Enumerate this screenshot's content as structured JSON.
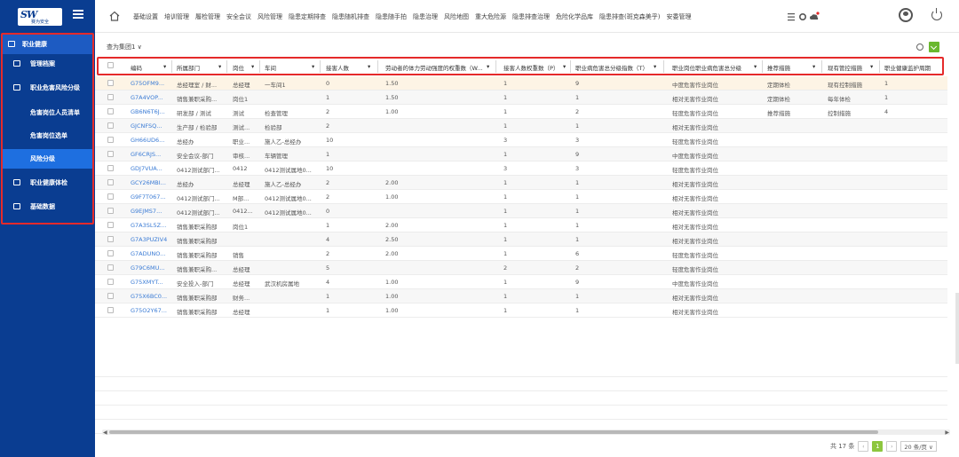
{
  "brand": {
    "logo_text": "SW",
    "logo_sub": "赛为安全"
  },
  "sidebar": {
    "items": [
      {
        "label": "职业健康",
        "top": true
      },
      {
        "label": "管理档案"
      },
      {
        "label": "职业危害风险分级"
      },
      {
        "label": "危害岗位人员清单",
        "sub": true
      },
      {
        "label": "危害岗位选单",
        "sub": true
      },
      {
        "label": "风险分级",
        "sub": true,
        "active": true
      },
      {
        "label": "职业健康体检"
      },
      {
        "label": "基础数据"
      }
    ]
  },
  "nav": {
    "items": [
      "基础设置",
      "培训管理",
      "履检管理",
      "安全会议",
      "风险管理",
      "隐患定期排查",
      "隐患随机排查",
      "隐患随手拍",
      "隐患治理",
      "风险地图",
      "重大危险源",
      "隐患排查治理",
      "危险化学品库",
      "隐患排查(斑克森美乎)",
      "安委管理"
    ]
  },
  "toolbar": {
    "filter_label": "查为集团1 ∨"
  },
  "table": {
    "headers": [
      "编码",
      "所属部门",
      "岗位",
      "车间",
      "接害人数",
      "劳动者的体力劳动强度的权重数（W...",
      "接害人数权重数（P）",
      "职业病危害总分级指数（T）",
      "职业岗位职业病危害总分级",
      "推荐措施",
      "现有管控措施",
      "职业健康监护周期"
    ],
    "rows": [
      [
        "G75OFM9...",
        "总经理室 / 财...",
        "总经理",
        "一车间1",
        "0",
        "1.50",
        "1",
        "9",
        "中度危害作业岗位",
        "定期体检",
        "现有控制措施",
        "1"
      ],
      [
        "G7A4VOP...",
        "销售兼职采购...",
        "岗位1",
        "",
        "1",
        "1.50",
        "1",
        "1",
        "相对无害作业岗位",
        "定期体检",
        "每年体检",
        "1"
      ],
      [
        "GB6N6T6J...",
        "研发部 / 测试",
        "测试",
        "检查管理",
        "2",
        "1.00",
        "1",
        "2",
        "轻度危害作业岗位",
        "推荐措施",
        "控制措施",
        "4"
      ],
      [
        "GJCNFSQ...",
        "生产部 / 检验部",
        "测试...",
        "检验部",
        "2",
        "",
        "1",
        "1",
        "相对无害作业岗位",
        "",
        "",
        ""
      ],
      [
        "GH66UD6...",
        "总经办",
        "职业...",
        "施人乙-总经办",
        "10",
        "",
        "3",
        "3",
        "轻度危害作业岗位",
        "",
        "",
        ""
      ],
      [
        "GF6CRJS...",
        "安全会议-部门",
        "审核...",
        "车辆管理",
        "1",
        "",
        "1",
        "9",
        "中度危害作业岗位",
        "",
        "",
        ""
      ],
      [
        "GDJ7VUA...",
        "0412测试部门...",
        "0412",
        "0412测试属地0...",
        "10",
        "",
        "3",
        "3",
        "轻度危害作业岗位",
        "",
        "",
        ""
      ],
      [
        "GCY26MBI...",
        "总经办",
        "总经理",
        "施人乙-总经办",
        "2",
        "2.00",
        "1",
        "1",
        "相对无害作业岗位",
        "",
        "",
        ""
      ],
      [
        "G9F7T067...",
        "0412测试部门...",
        "M部...",
        "0412测试属地0...",
        "2",
        "1.00",
        "1",
        "1",
        "相对无害作业岗位",
        "",
        "",
        ""
      ],
      [
        "G9EJMS7...",
        "0412测试部门...",
        "0412...",
        "0412测试属地0...",
        "0",
        "",
        "1",
        "1",
        "相对无害作业岗位",
        "",
        "",
        ""
      ],
      [
        "G7A3SL5Z...",
        "销售兼职采购部",
        "岗位1",
        "",
        "1",
        "2.00",
        "1",
        "1",
        "相对无害作业岗位",
        "",
        "",
        ""
      ],
      [
        "G7A3PUZIV4",
        "销售兼职采购部",
        "",
        "",
        "4",
        "2.50",
        "1",
        "1",
        "相对无害作业岗位",
        "",
        "",
        ""
      ],
      [
        "G7ADUNO...",
        "销售兼职采购部",
        "销售",
        "",
        "2",
        "2.00",
        "1",
        "6",
        "轻度危害作业岗位",
        "",
        "",
        ""
      ],
      [
        "G79C6MU...",
        "销售兼职采购...",
        "总经理",
        "",
        "5",
        "",
        "2",
        "2",
        "轻度危害作业岗位",
        "",
        "",
        ""
      ],
      [
        "G75XMYT...",
        "安全投入-部门",
        "总经理",
        "武汉机房属地",
        "4",
        "1.00",
        "1",
        "9",
        "中度危害作业岗位",
        "",
        "",
        ""
      ],
      [
        "G75X6BC0...",
        "销售兼职采购部",
        "财务...",
        "",
        "1",
        "1.00",
        "1",
        "1",
        "相对无害作业岗位",
        "",
        "",
        ""
      ],
      [
        "G75O2Y67...",
        "销售兼职采购部",
        "总经理",
        "",
        "1",
        "1.00",
        "1",
        "1",
        "相对无害作业岗位",
        "",
        "",
        ""
      ]
    ]
  },
  "pager": {
    "total": "共 17 条",
    "current": "1",
    "page_size": "20 条/页 ∨"
  },
  "colors": {
    "sidebar": "#0a3d91",
    "active": "#1e6fe0",
    "highlight": "#e52a2a",
    "accent_green": "#8dc63f"
  }
}
